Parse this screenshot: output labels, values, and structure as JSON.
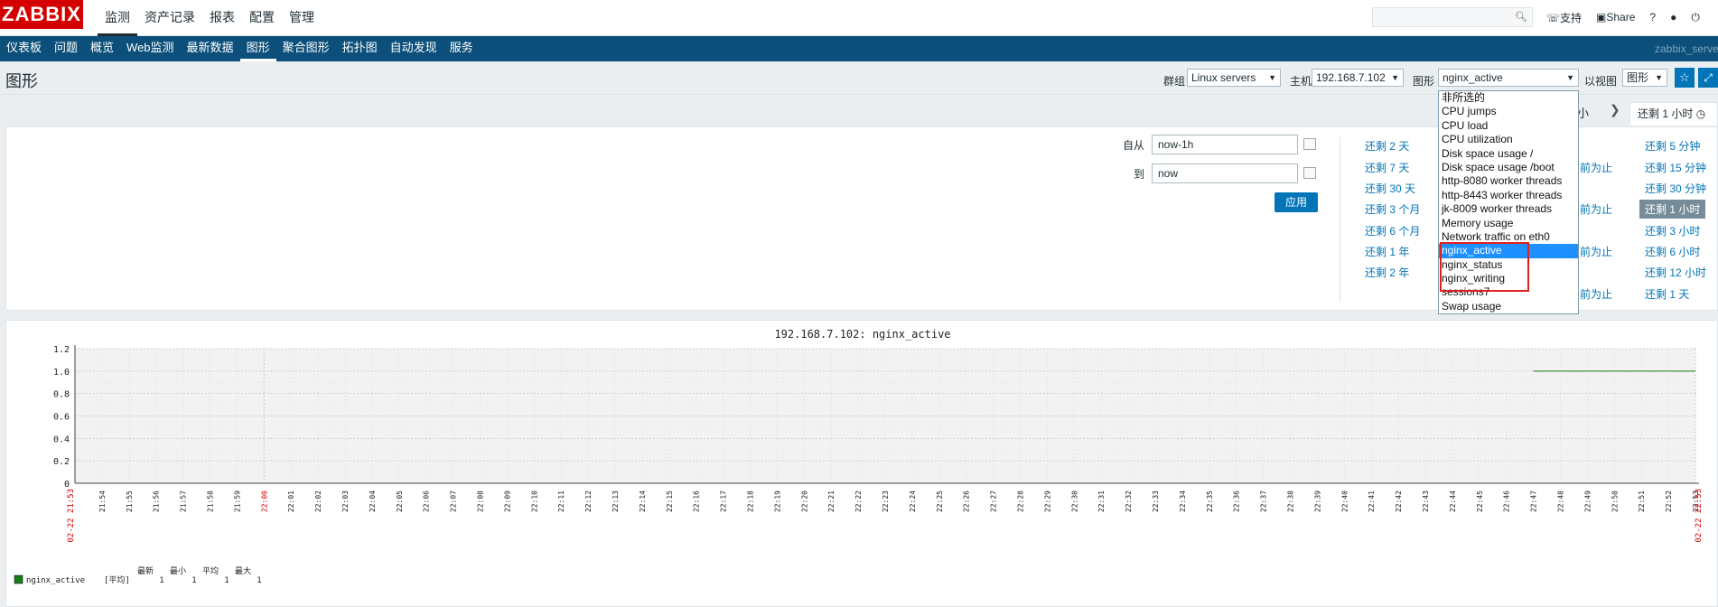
{
  "app": {
    "logo": "ZABBIX"
  },
  "topmenu": [
    "监测",
    "资产记录",
    "报表",
    "配置",
    "管理"
  ],
  "topright": {
    "support": "支持",
    "share": "Share",
    "help": "?",
    "user_icon": "user-icon",
    "power_icon": "power-icon"
  },
  "subnav": {
    "items": [
      "仪表板",
      "问题",
      "概览",
      "Web监测",
      "最新数据",
      "图形",
      "聚合图形",
      "拓扑图",
      "自动发现",
      "服务"
    ],
    "active": "图形",
    "server": "zabbix_serve"
  },
  "header": {
    "title": "图形",
    "group_label": "群组",
    "group_value": "Linux servers",
    "host_label": "主机",
    "host_value": "192.168.7.102",
    "graph_label": "图形",
    "graph_value": "nginx_active",
    "view_label": "以视图",
    "view_value": "图形"
  },
  "tabrow": {
    "zoom_out": "小",
    "current": "还剩 1 小时"
  },
  "filter": {
    "from_label": "自从",
    "from_value": "now-1h",
    "to_label": "到",
    "to_value": "now",
    "apply_label": "应用",
    "quick_left": [
      "还剩 2 天",
      "还剩 7 天",
      "还剩 30 天",
      "还剩 3 个月",
      "还剩 6 个月",
      "还剩 1 年",
      "还剩 2 年"
    ],
    "quick_mid": [
      "前为止",
      "前为止",
      "前为止",
      "前为止"
    ],
    "quick_right": [
      "还剩 5 分钟",
      "还剩 15 分钟",
      "还剩 30 分钟",
      "还剩 1 小时",
      "还剩 3 小时",
      "还剩 6 小时",
      "还剩 12 小时",
      "还剩 1 天"
    ],
    "selected_right": "还剩 1 小时"
  },
  "dropdown": {
    "options": [
      "非所选的",
      "CPU jumps",
      "CPU load",
      "CPU utilization",
      "Disk space usage /",
      "Disk space usage /boot",
      "http-8080 worker threads",
      "http-8443 worker threads",
      "jk-8009 worker threads",
      "Memory usage",
      "Network traffic on eth0",
      "nginx_active",
      "nginx_status",
      "nginx_writing",
      "sessions7",
      "Swap usage"
    ],
    "highlighted": "nginx_active"
  },
  "chart_data": {
    "type": "line",
    "title": "192.168.7.102: nginx_active",
    "ylim": [
      0,
      1.2
    ],
    "yticks": [
      "1.2",
      "1.0",
      "0.8",
      "0.6",
      "0.4",
      "0.2",
      "0"
    ],
    "x_start_label": "02-22 21:53",
    "x_end_label": "02-22 22:53",
    "xticks": [
      "21:54",
      "21:55",
      "21:56",
      "21:57",
      "21:58",
      "21:59",
      "22:00",
      "22:01",
      "22:02",
      "22:03",
      "22:04",
      "22:05",
      "22:06",
      "22:07",
      "22:08",
      "22:09",
      "22:10",
      "22:11",
      "22:12",
      "22:13",
      "22:14",
      "22:15",
      "22:16",
      "22:17",
      "22:18",
      "22:19",
      "22:20",
      "22:21",
      "22:22",
      "22:23",
      "22:24",
      "22:25",
      "22:26",
      "22:27",
      "22:28",
      "22:29",
      "22:30",
      "22:31",
      "22:32",
      "22:33",
      "22:34",
      "22:35",
      "22:36",
      "22:37",
      "22:38",
      "22:39",
      "22:40",
      "22:41",
      "22:42",
      "22:43",
      "22:44",
      "22:45",
      "22:46",
      "22:47",
      "22:48",
      "22:49",
      "22:50",
      "22:51",
      "22:52",
      "22:53"
    ],
    "series": [
      {
        "name": "nginx_active",
        "color": "#1a7c1a",
        "points": [
          [
            "22:47",
            1
          ],
          [
            "22:53",
            1
          ]
        ]
      }
    ],
    "legend": {
      "headers": [
        "最新",
        "最小",
        "平均",
        "最大"
      ],
      "rows": [
        {
          "name": "nginx_active",
          "func": "[平均]",
          "values": [
            "1",
            "1",
            "1",
            "1"
          ]
        }
      ]
    }
  }
}
